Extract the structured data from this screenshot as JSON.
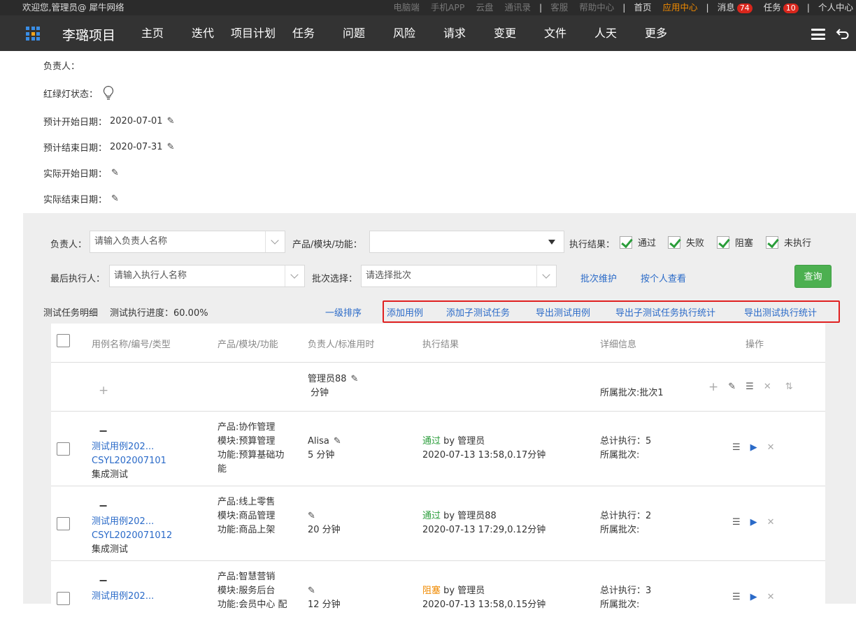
{
  "topbar": {
    "welcome": "欢迎您,管理员@ 犀牛网络",
    "links": [
      "电脑端",
      "手机APP",
      "云盘",
      "通讯录"
    ],
    "links2": [
      "客服",
      "帮助中心"
    ],
    "home": "首页",
    "app_center": "应用中心",
    "messages": "消息",
    "messages_count": "74",
    "tasks": "任务",
    "tasks_count": "10",
    "personal": "个人中心"
  },
  "nav": {
    "project": "李璐项目",
    "items": [
      "主页",
      "迭代",
      "项目计划",
      "任务",
      "问题",
      "风险",
      "请求",
      "变更",
      "文件",
      "人天",
      "更多"
    ]
  },
  "info": {
    "owner_label": "负责人：",
    "light_label": "红绿灯状态：",
    "plan_start_label": "预计开始日期：",
    "plan_start": "2020-07-01",
    "plan_end_label": "预计结束日期：",
    "plan_end": "2020-07-31",
    "actual_start_label": "实际开始日期：",
    "actual_end_label": "实际结束日期："
  },
  "filters": {
    "owner_label": "负责人：",
    "owner_placeholder": "请输入负责人名称",
    "product_label": "产品/模块/功能：",
    "result_label": "执行结果：",
    "results": [
      "通过",
      "失败",
      "阻塞",
      "未执行"
    ],
    "executor_label": "最后执行人：",
    "executor_placeholder": "请输入执行人名称",
    "batch_label": "批次选择：",
    "batch_placeholder": "请选择批次",
    "batch_maint": "批次维护",
    "by_person": "按个人查看",
    "query": "查询"
  },
  "toolbar": {
    "detail_title": "测试任务明细",
    "progress": "测试执行进度：60.00%",
    "sort": "一级排序",
    "add_case": "添加用例",
    "add_sub": "添加子测试任务",
    "export_case": "导出测试用例",
    "export_sub": "导出子测试任务执行统计",
    "export_exec": "导出测试执行统计"
  },
  "table": {
    "headers": [
      "用例名称/编号/类型",
      "产品/模块/功能",
      "负责人/标准用时",
      "执行结果",
      "详细信息",
      "操作"
    ],
    "sub_row": {
      "owner": "管理员88",
      "time": "分钟",
      "batch": "所属批次:批次1"
    },
    "rows": [
      {
        "name": "测试用例202...",
        "code": "CSYL202007101",
        "type": "集成测试",
        "product": "产品:协作管理",
        "module": "模块:预算管理",
        "func1": "功能:预算基础功",
        "func2": "能",
        "owner": "Alisa",
        "time": "5 分钟",
        "status": "通过",
        "by": " by 管理员",
        "exec_time": "2020-07-13 13:58,0.17分钟",
        "total": "总计执行：5",
        "batch": "所属批次:"
      },
      {
        "name": "测试用例202...",
        "code": "CSYL2020071012",
        "type": "集成测试",
        "product": "产品:线上零售",
        "module": "模块:商品管理",
        "func1": "功能:商品上架",
        "func2": "",
        "owner": "",
        "time": "20 分钟",
        "status": "通过",
        "by": " by 管理员88",
        "exec_time": "2020-07-13 17:29,0.12分钟",
        "total": "总计执行：2",
        "batch": "所属批次:"
      },
      {
        "name": "测试用例202...",
        "code": "",
        "type": "",
        "product": "产品:智慧营销",
        "module": "模块:服务后台",
        "func1": "功能:会员中心 配",
        "func2": "",
        "owner": "",
        "time": "12 分钟",
        "status": "阻塞",
        "by": " by 管理员",
        "exec_time": "2020-07-13 13:58,0.15分钟",
        "total": "总计执行：3",
        "batch": "所属批次:"
      }
    ]
  }
}
